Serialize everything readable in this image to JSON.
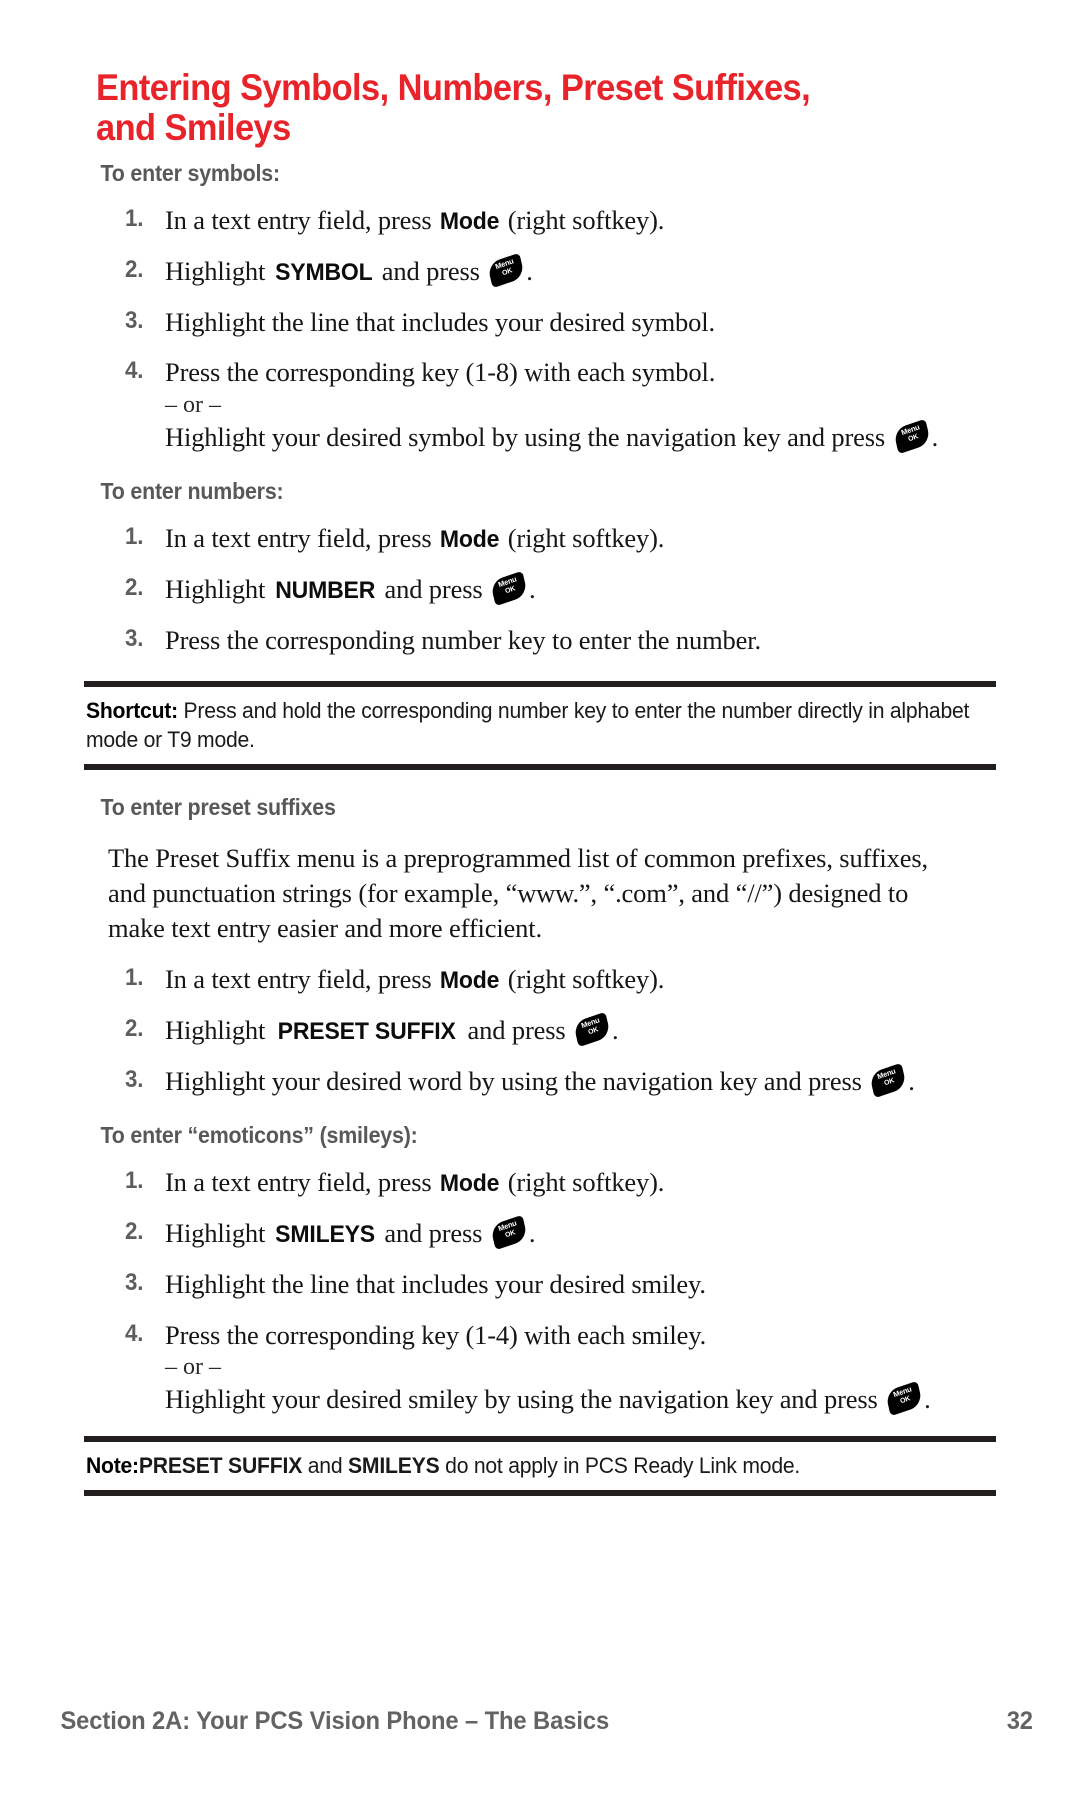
{
  "title": "Entering Symbols, Numbers, Preset Suffixes, and Smileys",
  "accent_color": "#e8232a",
  "key_icon": {
    "line1": "Menu",
    "line2": "OK"
  },
  "sections": {
    "symbols": {
      "heading": "To enter symbols:",
      "steps": [
        {
          "num": "1.",
          "pre": "In a text entry field, press ",
          "term": "Mode",
          "post": " (right softkey)."
        },
        {
          "num": "2.",
          "pre": "Highlight ",
          "term": "SYMBOL",
          "post": " and press ",
          "icon": true,
          "tail": "."
        },
        {
          "num": "3.",
          "pre": "Highlight the line that includes your desired symbol."
        },
        {
          "num": "4.",
          "pre": "Press the corresponding key (1-8) with each symbol."
        }
      ],
      "or_label": "– or –",
      "alt_pre": "Highlight your desired symbol by using the navigation key and press ",
      "alt_tail": "."
    },
    "numbers": {
      "heading": "To enter numbers:",
      "steps": [
        {
          "num": "1.",
          "pre": "In a text entry field, press ",
          "term": "Mode",
          "post": " (right softkey)."
        },
        {
          "num": "2.",
          "pre": "Highlight ",
          "term": "NUMBER",
          "post": " and press ",
          "icon": true,
          "tail": "."
        },
        {
          "num": "3.",
          "pre": "Press the corresponding number key to enter the number."
        }
      ]
    },
    "shortcut": {
      "label": "Shortcut:",
      "text": " Press and hold the corresponding number key to enter the number directly in alphabet mode or T9 mode."
    },
    "preset_suffixes": {
      "heading": "To enter preset suffixes",
      "paragraph": "The Preset Suffix menu is a preprogrammed list of common prefixes, suffixes, and punctuation strings (for example, “www.”, “.com”, and “//”) designed to make text entry easier and more efficient.",
      "steps": [
        {
          "num": "1.",
          "pre": "In a text entry field, press ",
          "term": "Mode",
          "post": " (right softkey)."
        },
        {
          "num": "2.",
          "pre": "Highlight ",
          "term": "PRESET SUFFIX",
          "post": " and press ",
          "icon": true,
          "tail": "."
        },
        {
          "num": "3.",
          "pre": "Highlight your desired word by using the navigation key and press ",
          "icon": true,
          "tail": "."
        }
      ]
    },
    "emoticons": {
      "heading": "To enter “emoticons” (smileys):",
      "steps": [
        {
          "num": "1.",
          "pre": "In a text entry field, press ",
          "term": "Mode",
          "post": " (right softkey)."
        },
        {
          "num": "2.",
          "pre": "Highlight ",
          "term": "SMILEYS",
          "post": " and press ",
          "icon": true,
          "tail": "."
        },
        {
          "num": "3.",
          "pre": "Highlight the line that includes your desired smiley."
        },
        {
          "num": "4.",
          "pre": "Press the corresponding key (1-4) with each smiley."
        }
      ],
      "or_label": "– or –",
      "alt_pre": "Highlight your desired smiley by using the navigation key and press ",
      "alt_tail": "."
    },
    "note": {
      "label": "Note:",
      "term1": "PRESET SUFFIX",
      "mid": " and ",
      "term2": "SMILEYS",
      "text": " do not apply in PCS Ready Link mode."
    }
  },
  "footer": {
    "section": "Section 2A: Your PCS Vision Phone – The Basics",
    "page": "32"
  }
}
